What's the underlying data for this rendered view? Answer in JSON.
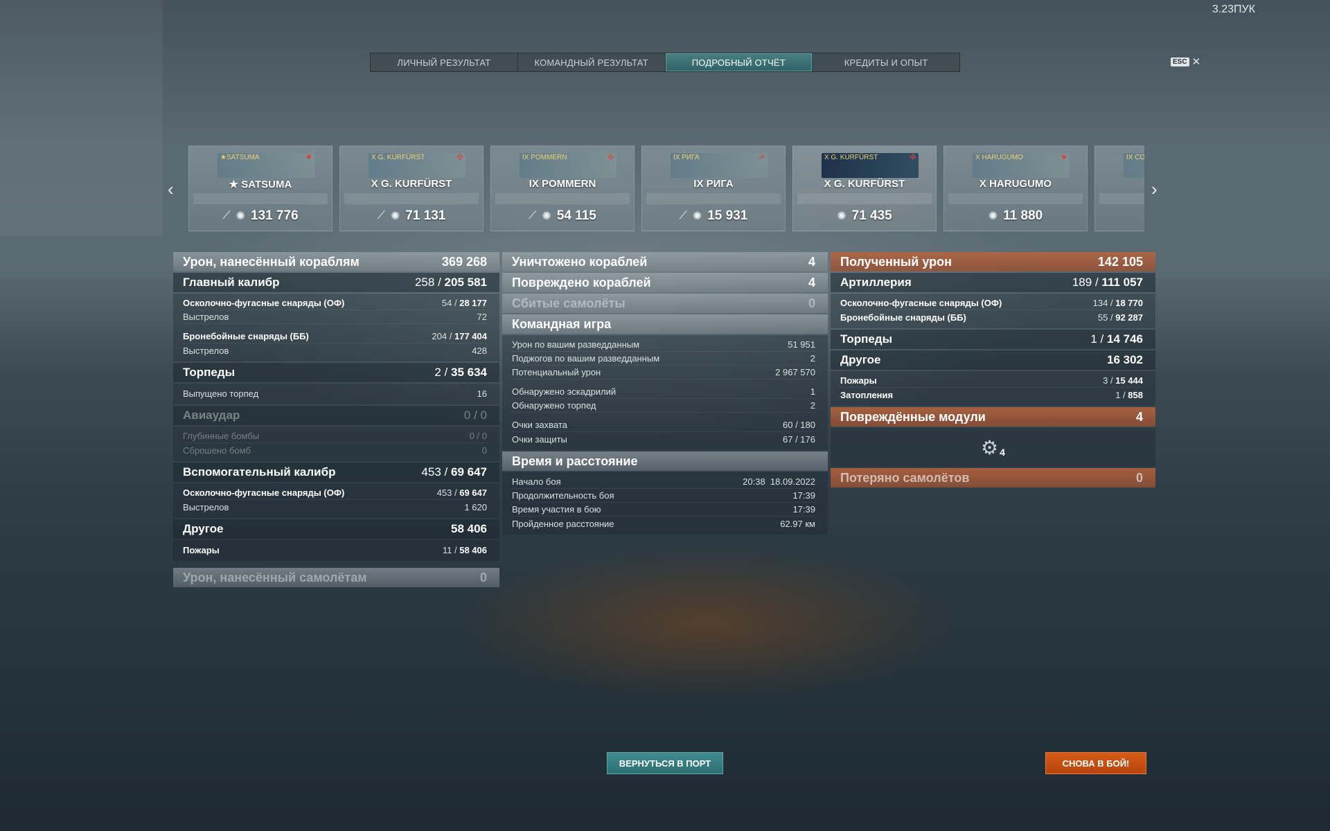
{
  "version": "3.23ПУК",
  "tabs": [
    {
      "label": "ЛИЧНЫЙ РЕЗУЛЬТАТ",
      "active": false
    },
    {
      "label": "КОМАНДНЫЙ РЕЗУЛЬТАТ",
      "active": false
    },
    {
      "label": "ПОДРОБНЫЙ ОТЧЁТ",
      "active": true
    },
    {
      "label": "КРЕДИТЫ И ОПЫТ",
      "active": false
    }
  ],
  "esc": {
    "key": "ESC",
    "close": "✕"
  },
  "carousel": {
    "prev": "‹",
    "next": "›",
    "ships": [
      {
        "thumb_name": "★SATSUMA",
        "title": "★ SATSUMA",
        "damage": "131 776",
        "self": false
      },
      {
        "thumb_name": "X G. KURFÜRST",
        "title": "X G. KURFÜRST",
        "damage": "71 131",
        "self": false
      },
      {
        "thumb_name": "IX POMMERN",
        "title": "IX POMMERN",
        "damage": "54 115",
        "self": false
      },
      {
        "thumb_name": "IX РИГА",
        "title": "IX РИГА",
        "damage": "15 931",
        "self": false
      },
      {
        "thumb_name": "X G. KURFÜRST",
        "title": "X G. KURFÜRST",
        "damage": "71 435",
        "self": true
      },
      {
        "thumb_name": "X HARUGUMO",
        "title": "X HARUGUMO",
        "damage": "11 880",
        "self": false
      },
      {
        "thumb_name": "IX CO",
        "title": "",
        "damage": "",
        "self": false
      }
    ]
  },
  "col1": {
    "damage_ships": {
      "label": "Урон, нанесённый кораблям",
      "value": "369 268"
    },
    "main_battery": {
      "label": "Главный калибр",
      "hits": "258",
      "sep": "/",
      "value": "205 581"
    },
    "he_label": "Осколочно-фугасные снаряды (ОФ)",
    "he_hits": "54",
    "he_sep": "/",
    "he_val": "28 177",
    "he_shots_label": "Выстрелов",
    "he_shots": "72",
    "ap_label": "Бронебойные снаряды (ББ)",
    "ap_hits": "204",
    "ap_sep": "/",
    "ap_val": "177 404",
    "ap_shots_label": "Выстрелов",
    "ap_shots": "428",
    "torpedoes": {
      "label": "Торпеды",
      "hits": "2",
      "sep": "/",
      "value": "35 634"
    },
    "torp_launched_label": "Выпущено торпед",
    "torp_launched": "16",
    "aviation": {
      "label": "Авиаудар",
      "value": "0 / 0"
    },
    "depth_label": "Глубинные бомбы",
    "depth_val": "0 / 0",
    "bombs_label": "Сброшено бомб",
    "bombs_val": "0",
    "secondary": {
      "label": "Вспомогательный калибр",
      "hits": "453",
      "sep": "/",
      "value": "69 647"
    },
    "sec_he_label": "Осколочно-фугасные снаряды (ОФ)",
    "sec_he_hits": "453",
    "sec_he_sep": "/",
    "sec_he_val": "69 647",
    "sec_shots_label": "Выстрелов",
    "sec_shots": "1 620",
    "other": {
      "label": "Другое",
      "value": "58 406"
    },
    "fires_label": "Пожары",
    "fires_hits": "11",
    "fires_sep": "/",
    "fires_val": "58 406",
    "damage_planes": {
      "label": "Урон, нанесённый самолётам",
      "value": "0"
    }
  },
  "col2": {
    "destroyed": {
      "label": "Уничтожено кораблей",
      "value": "4"
    },
    "damaged": {
      "label": "Повреждено кораблей",
      "value": "4"
    },
    "planes_shot": {
      "label": "Сбитые самолёты",
      "value": "0"
    },
    "team_play": {
      "label": "Командная игра"
    },
    "spotting_damage_label": "Урон по вашим разведданным",
    "spotting_damage": "51 951",
    "spotting_fires_label": "Поджогов по вашим разведданным",
    "spotting_fires": "2",
    "potential_label": "Потенциальный урон",
    "potential": "2 967 570",
    "squadrons_label": "Обнаружено эскадрилий",
    "squadrons": "1",
    "torps_spotted_label": "Обнаружено торпед",
    "torps_spotted": "2",
    "capture_label": "Очки захвата",
    "capture": "60 / 180",
    "defense_label": "Очки защиты",
    "defense": "67 / 176",
    "time_distance": {
      "label": "Время и расстояние"
    },
    "start_label": "Начало боя",
    "start": "20:38  18.09.2022",
    "duration_label": "Продолжительность боя",
    "duration": "17:39",
    "participation_label": "Время участия в бою",
    "participation": "17:39",
    "distance_label": "Пройденное расстояние",
    "distance": "62.97 км"
  },
  "col3": {
    "received": {
      "label": "Полученный урон",
      "value": "142 105"
    },
    "artillery": {
      "label": "Артиллерия",
      "hits": "189",
      "sep": "/",
      "value": "111 057"
    },
    "he_label": "Осколочно-фугасные снаряды (ОФ)",
    "he_hits": "134",
    "he_sep": "/",
    "he_val": "18 770",
    "ap_label": "Бронебойные снаряды (ББ)",
    "ap_hits": "55",
    "ap_sep": "/",
    "ap_val": "92 287",
    "torpedoes": {
      "label": "Торпеды",
      "hits": "1",
      "sep": "/",
      "value": "14 746"
    },
    "other": {
      "label": "Другое",
      "value": "16 302"
    },
    "fires_label": "Пожары",
    "fires_hits": "3",
    "fires_sep": "/",
    "fires_val": "15 444",
    "flooding_label": "Затопления",
    "flooding_hits": "1",
    "flooding_sep": "/",
    "flooding_val": "858",
    "modules": {
      "label": "Повреждённые модули",
      "value": "4",
      "count": "4"
    },
    "planes_lost": {
      "label": "Потеряно самолётов",
      "value": "0"
    }
  },
  "buttons": {
    "port": "ВЕРНУТЬСЯ В ПОРТ",
    "battle": "СНОВА В БОЙ!"
  }
}
